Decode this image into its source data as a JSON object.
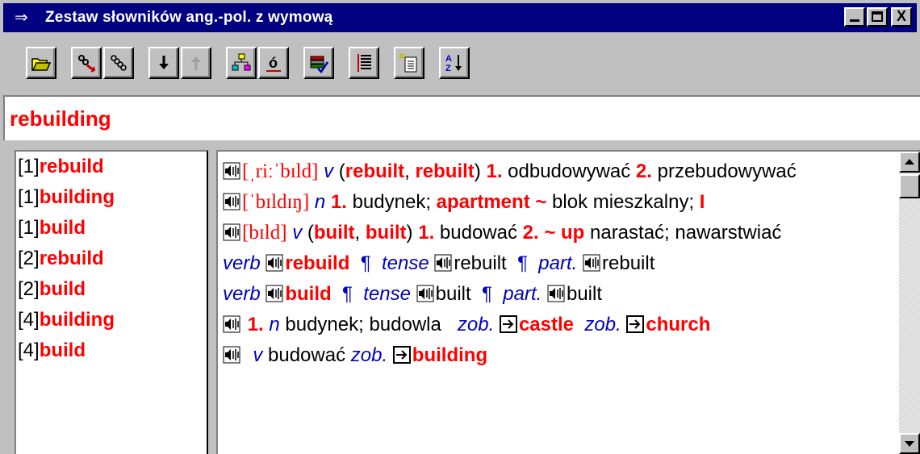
{
  "window": {
    "title": "Zestaw słowników ang.-pol. z wymową",
    "close_label": "X"
  },
  "search": {
    "value": "rebuilding"
  },
  "left_list": [
    {
      "num": "[1]",
      "word": "rebuild"
    },
    {
      "num": "[1]",
      "word": "building"
    },
    {
      "num": "[1]",
      "word": "build"
    },
    {
      "num": "[2]",
      "word": "rebuild"
    },
    {
      "num": "[2]",
      "word": "build"
    },
    {
      "num": "[4]",
      "word": "building"
    },
    {
      "num": "[4]",
      "word": "build"
    }
  ],
  "entries": {
    "e1": {
      "pron": "[ˌriːˈbɪld]",
      "pos": "v",
      "open": " (",
      "f1": "rebuilt",
      "comma": ", ",
      "f2": "rebuilt",
      "close": ") ",
      "n1": "1.",
      "t1": " odbudowywać ",
      "n2": "2.",
      "t2": " przebudowywać"
    },
    "e2": {
      "pron": "[ˈbɪldɪŋ]",
      "pos": "n",
      "n1": "1.",
      "t1": " budynek; ",
      "phrase": "apartment ~",
      "t2": " blok mieszkalny; ",
      "more": "I"
    },
    "e3": {
      "pron": "[bɪld]",
      "pos": "v",
      "open": " (",
      "f1": "built",
      "comma": ", ",
      "f2": "built",
      "close": ") ",
      "n1": "1.",
      "t1": " budować ",
      "n2": "2. ~ up",
      "t2": " narastać; nawarstwiać"
    },
    "e4": {
      "label": "verb",
      "word": "rebuild",
      "pil1": "¶",
      "tense": "tense",
      "f1": "rebuilt",
      "pil2": "¶",
      "part": "part.",
      "f2": "rebuilt"
    },
    "e5": {
      "label": "verb",
      "word": "build",
      "pil1": "¶",
      "tense": "tense",
      "f1": "built",
      "pil2": "¶",
      "part": "part.",
      "f2": "built"
    },
    "e6": {
      "n1": "1.",
      "pos": "n",
      "t1": " budynek; budowla",
      "zob1": "zob.",
      "ref1": "castle",
      "zob2": "zob.",
      "ref2": "church"
    },
    "e7": {
      "pos": "v",
      "t1": " budować ",
      "zob": "zob.",
      "ref": "building"
    }
  },
  "colors": {
    "title_bg": "#000080",
    "headword": "#ff0000",
    "grammar": "#0000c0",
    "face": "#c0c0c0"
  },
  "icons": [
    "open-folder-icon",
    "unlink-icon",
    "link-icon",
    "arrow-down-icon",
    "arrow-up-icon",
    "tree-icon",
    "accent-o-icon",
    "books-check-icon",
    "list-icon",
    "new-page-icon",
    "sort-az-icon"
  ]
}
